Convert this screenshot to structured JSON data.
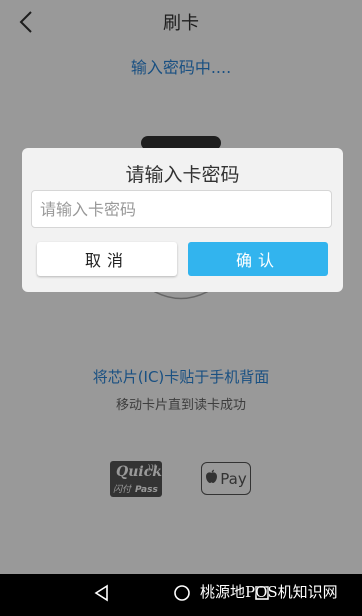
{
  "header": {
    "title": "刷卡",
    "back_icon": "chevron-left-icon"
  },
  "content": {
    "status_text": "输入密码中....",
    "instruction_text": "将芯片(IC)卡贴于手机背面",
    "sub_instruction_text": "移动卡片直到读卡成功",
    "logos": {
      "quickpass": {
        "word": "Quick",
        "cn": "闪付",
        "pass": "Pass"
      },
      "applepay": {
        "icon": "apple-icon",
        "text": "Pay"
      }
    }
  },
  "dialog": {
    "title": "请输入卡密码",
    "input_placeholder": "请输入卡密码",
    "input_value": "",
    "cancel_label": "取消",
    "confirm_label": "确认"
  },
  "navbar": {
    "back_icon": "triangle-back-icon",
    "home_icon": "circle-home-icon",
    "recents_icon": "square-recents-icon"
  },
  "watermark": "桃源地POS机知识网",
  "colors": {
    "accent_blue": "#2b86d9",
    "confirm_button": "#32b4ee",
    "dialog_background": "#f2f2f2",
    "navbar_background": "#000000"
  }
}
